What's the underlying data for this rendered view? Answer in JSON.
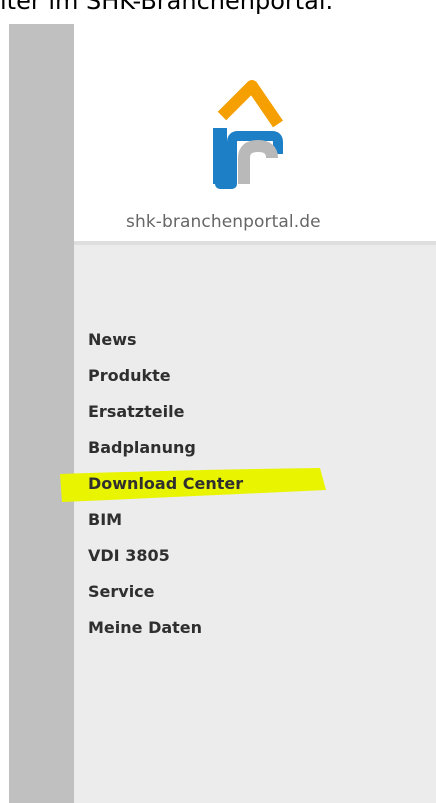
{
  "caption": "iter im SHK-Branchenportal.",
  "logo": {
    "text": "shk-branchenportal.de",
    "colors": {
      "roof": "#f5a000",
      "arch": "#1d7fc6",
      "inner": "#b9b9b9"
    }
  },
  "menu": {
    "items": [
      {
        "label": "News"
      },
      {
        "label": "Produkte"
      },
      {
        "label": "Ersatzteile"
      },
      {
        "label": "Badplanung"
      },
      {
        "label": "Download Center",
        "highlighted": true
      },
      {
        "label": "BIM"
      },
      {
        "label": "VDI 3805"
      },
      {
        "label": "Service"
      },
      {
        "label": "Meine Daten"
      }
    ]
  },
  "colors": {
    "highlight": "#e9f500",
    "strip": "#c0c0c0",
    "menu_bg": "#ececec"
  }
}
